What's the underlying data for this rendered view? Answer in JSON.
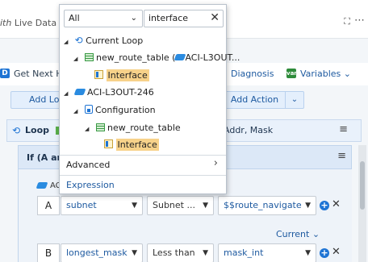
{
  "topbar": {
    "live_prefix": "ith",
    "live_text": "Live Data",
    "expand_icon": "⛶",
    "more_icon": "⋯"
  },
  "toolbar": {
    "d_icon": "D",
    "get_next": "Get Next H",
    "diagnosis": "Diagnosis",
    "variables": "Variables",
    "var_icon": "var"
  },
  "actions": {
    "add_lo": "Add Lo",
    "add_action": "Add Action"
  },
  "loop": {
    "label": "Loop",
    "addr": "Addr, Mask",
    "menu_icon": "≡"
  },
  "if_block": {
    "label": "If (A and",
    "menu_icon": "≡",
    "device_label": "AC"
  },
  "conditions": [
    {
      "letter": "A",
      "field": "subnet",
      "op": "Subnet ...",
      "value": "$$route_navigate"
    },
    {
      "letter": "B",
      "field": "longest_mask",
      "op": "Less than",
      "value": "mask_int"
    }
  ],
  "current_label": "Current",
  "popup": {
    "scope": "All",
    "search": "interface",
    "tree": [
      {
        "label": "Current Loop",
        "icon": "loop-icon",
        "level": 0
      },
      {
        "label": "new_route_table (",
        "suffix": "ACI-L3OUT...",
        "icon": "table-icon",
        "level": 1
      },
      {
        "label": "Interface",
        "icon": "field-icon",
        "level": 2,
        "highlight": true
      },
      {
        "label": "ACI-L3OUT-246",
        "icon": "device-icon",
        "level": 0
      },
      {
        "label": "Configuration",
        "icon": "config-icon",
        "level": 1
      },
      {
        "label": "new_route_table",
        "icon": "table-icon",
        "level": 2
      },
      {
        "label": "Interface",
        "icon": "field-icon",
        "level": 3,
        "highlight": true
      }
    ],
    "advanced": "Advanced",
    "expression": "Expression"
  },
  "colors": {
    "accent": "#1e74d4",
    "highlight": "#f7d28a",
    "panel": "#e9f1fb"
  }
}
